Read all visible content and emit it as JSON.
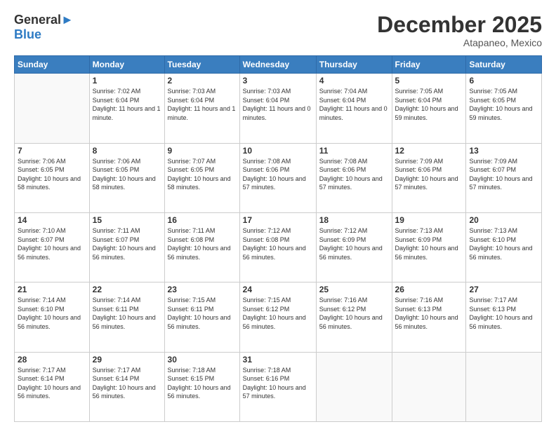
{
  "header": {
    "logo_general": "General",
    "logo_blue": "Blue",
    "month_title": "December 2025",
    "location": "Atapaneo, Mexico"
  },
  "days_of_week": [
    "Sunday",
    "Monday",
    "Tuesday",
    "Wednesday",
    "Thursday",
    "Friday",
    "Saturday"
  ],
  "weeks": [
    [
      {
        "num": "",
        "sunrise": "",
        "sunset": "",
        "daylight": ""
      },
      {
        "num": "1",
        "sunrise": "Sunrise: 7:02 AM",
        "sunset": "Sunset: 6:04 PM",
        "daylight": "Daylight: 11 hours and 1 minute."
      },
      {
        "num": "2",
        "sunrise": "Sunrise: 7:03 AM",
        "sunset": "Sunset: 6:04 PM",
        "daylight": "Daylight: 11 hours and 1 minute."
      },
      {
        "num": "3",
        "sunrise": "Sunrise: 7:03 AM",
        "sunset": "Sunset: 6:04 PM",
        "daylight": "Daylight: 11 hours and 0 minutes."
      },
      {
        "num": "4",
        "sunrise": "Sunrise: 7:04 AM",
        "sunset": "Sunset: 6:04 PM",
        "daylight": "Daylight: 11 hours and 0 minutes."
      },
      {
        "num": "5",
        "sunrise": "Sunrise: 7:05 AM",
        "sunset": "Sunset: 6:04 PM",
        "daylight": "Daylight: 10 hours and 59 minutes."
      },
      {
        "num": "6",
        "sunrise": "Sunrise: 7:05 AM",
        "sunset": "Sunset: 6:05 PM",
        "daylight": "Daylight: 10 hours and 59 minutes."
      }
    ],
    [
      {
        "num": "7",
        "sunrise": "Sunrise: 7:06 AM",
        "sunset": "Sunset: 6:05 PM",
        "daylight": "Daylight: 10 hours and 58 minutes."
      },
      {
        "num": "8",
        "sunrise": "Sunrise: 7:06 AM",
        "sunset": "Sunset: 6:05 PM",
        "daylight": "Daylight: 10 hours and 58 minutes."
      },
      {
        "num": "9",
        "sunrise": "Sunrise: 7:07 AM",
        "sunset": "Sunset: 6:05 PM",
        "daylight": "Daylight: 10 hours and 58 minutes."
      },
      {
        "num": "10",
        "sunrise": "Sunrise: 7:08 AM",
        "sunset": "Sunset: 6:06 PM",
        "daylight": "Daylight: 10 hours and 57 minutes."
      },
      {
        "num": "11",
        "sunrise": "Sunrise: 7:08 AM",
        "sunset": "Sunset: 6:06 PM",
        "daylight": "Daylight: 10 hours and 57 minutes."
      },
      {
        "num": "12",
        "sunrise": "Sunrise: 7:09 AM",
        "sunset": "Sunset: 6:06 PM",
        "daylight": "Daylight: 10 hours and 57 minutes."
      },
      {
        "num": "13",
        "sunrise": "Sunrise: 7:09 AM",
        "sunset": "Sunset: 6:07 PM",
        "daylight": "Daylight: 10 hours and 57 minutes."
      }
    ],
    [
      {
        "num": "14",
        "sunrise": "Sunrise: 7:10 AM",
        "sunset": "Sunset: 6:07 PM",
        "daylight": "Daylight: 10 hours and 56 minutes."
      },
      {
        "num": "15",
        "sunrise": "Sunrise: 7:11 AM",
        "sunset": "Sunset: 6:07 PM",
        "daylight": "Daylight: 10 hours and 56 minutes."
      },
      {
        "num": "16",
        "sunrise": "Sunrise: 7:11 AM",
        "sunset": "Sunset: 6:08 PM",
        "daylight": "Daylight: 10 hours and 56 minutes."
      },
      {
        "num": "17",
        "sunrise": "Sunrise: 7:12 AM",
        "sunset": "Sunset: 6:08 PM",
        "daylight": "Daylight: 10 hours and 56 minutes."
      },
      {
        "num": "18",
        "sunrise": "Sunrise: 7:12 AM",
        "sunset": "Sunset: 6:09 PM",
        "daylight": "Daylight: 10 hours and 56 minutes."
      },
      {
        "num": "19",
        "sunrise": "Sunrise: 7:13 AM",
        "sunset": "Sunset: 6:09 PM",
        "daylight": "Daylight: 10 hours and 56 minutes."
      },
      {
        "num": "20",
        "sunrise": "Sunrise: 7:13 AM",
        "sunset": "Sunset: 6:10 PM",
        "daylight": "Daylight: 10 hours and 56 minutes."
      }
    ],
    [
      {
        "num": "21",
        "sunrise": "Sunrise: 7:14 AM",
        "sunset": "Sunset: 6:10 PM",
        "daylight": "Daylight: 10 hours and 56 minutes."
      },
      {
        "num": "22",
        "sunrise": "Sunrise: 7:14 AM",
        "sunset": "Sunset: 6:11 PM",
        "daylight": "Daylight: 10 hours and 56 minutes."
      },
      {
        "num": "23",
        "sunrise": "Sunrise: 7:15 AM",
        "sunset": "Sunset: 6:11 PM",
        "daylight": "Daylight: 10 hours and 56 minutes."
      },
      {
        "num": "24",
        "sunrise": "Sunrise: 7:15 AM",
        "sunset": "Sunset: 6:12 PM",
        "daylight": "Daylight: 10 hours and 56 minutes."
      },
      {
        "num": "25",
        "sunrise": "Sunrise: 7:16 AM",
        "sunset": "Sunset: 6:12 PM",
        "daylight": "Daylight: 10 hours and 56 minutes."
      },
      {
        "num": "26",
        "sunrise": "Sunrise: 7:16 AM",
        "sunset": "Sunset: 6:13 PM",
        "daylight": "Daylight: 10 hours and 56 minutes."
      },
      {
        "num": "27",
        "sunrise": "Sunrise: 7:17 AM",
        "sunset": "Sunset: 6:13 PM",
        "daylight": "Daylight: 10 hours and 56 minutes."
      }
    ],
    [
      {
        "num": "28",
        "sunrise": "Sunrise: 7:17 AM",
        "sunset": "Sunset: 6:14 PM",
        "daylight": "Daylight: 10 hours and 56 minutes."
      },
      {
        "num": "29",
        "sunrise": "Sunrise: 7:17 AM",
        "sunset": "Sunset: 6:14 PM",
        "daylight": "Daylight: 10 hours and 56 minutes."
      },
      {
        "num": "30",
        "sunrise": "Sunrise: 7:18 AM",
        "sunset": "Sunset: 6:15 PM",
        "daylight": "Daylight: 10 hours and 56 minutes."
      },
      {
        "num": "31",
        "sunrise": "Sunrise: 7:18 AM",
        "sunset": "Sunset: 6:16 PM",
        "daylight": "Daylight: 10 hours and 57 minutes."
      },
      {
        "num": "",
        "sunrise": "",
        "sunset": "",
        "daylight": ""
      },
      {
        "num": "",
        "sunrise": "",
        "sunset": "",
        "daylight": ""
      },
      {
        "num": "",
        "sunrise": "",
        "sunset": "",
        "daylight": ""
      }
    ]
  ]
}
